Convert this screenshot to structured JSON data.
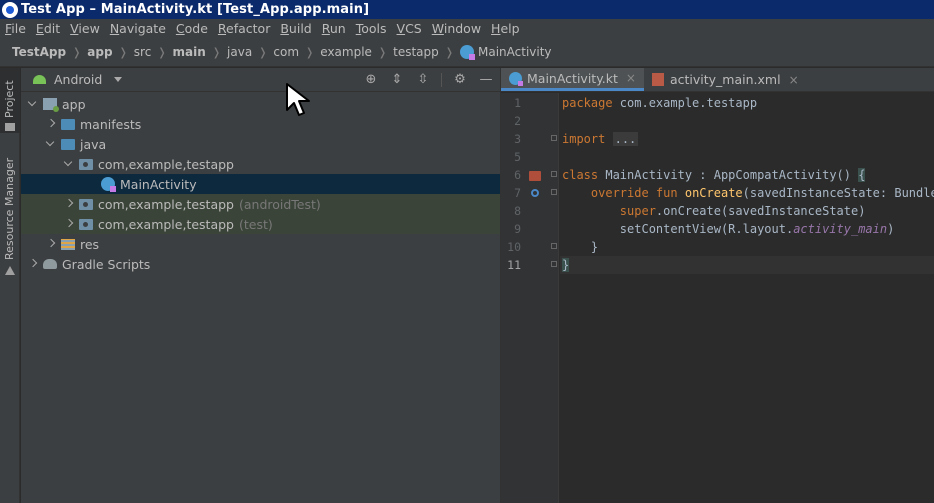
{
  "window": {
    "title": "Test App – MainActivity.kt [Test_App.app.main]"
  },
  "menu": [
    {
      "label": "File",
      "m": "F",
      "rest": "ile"
    },
    {
      "label": "Edit",
      "m": "E",
      "rest": "dit"
    },
    {
      "label": "View",
      "m": "V",
      "rest": "iew"
    },
    {
      "label": "Navigate",
      "m": "N",
      "rest": "avigate"
    },
    {
      "label": "Code",
      "m": "C",
      "rest": "ode"
    },
    {
      "label": "Refactor",
      "m": "R",
      "rest": "efactor"
    },
    {
      "label": "Build",
      "m": "B",
      "rest": "uild"
    },
    {
      "label": "Run",
      "m": "R",
      "rest": "un"
    },
    {
      "label": "Tools",
      "m": "T",
      "rest": "ools"
    },
    {
      "label": "VCS",
      "m": "V",
      "rest": "CS"
    },
    {
      "label": "Window",
      "m": "W",
      "rest": "indow"
    },
    {
      "label": "Help",
      "m": "H",
      "rest": "elp"
    }
  ],
  "breadcrumb": [
    "TestApp",
    "app",
    "src",
    "main",
    "java",
    "com",
    "example",
    "testapp",
    "MainActivity"
  ],
  "side_tabs": {
    "project": "Project",
    "resource_manager": "Resource Manager"
  },
  "project_panel": {
    "view_mode": "Android",
    "tree": [
      {
        "label": "app",
        "suffix": ""
      },
      {
        "label": "manifests",
        "suffix": ""
      },
      {
        "label": "java",
        "suffix": ""
      },
      {
        "label": "com,example,testapp",
        "suffix": ""
      },
      {
        "label": "MainActivity",
        "suffix": ""
      },
      {
        "label": "com,example,testapp",
        "suffix": "(androidTest)"
      },
      {
        "label": "com,example,testapp",
        "suffix": "(test)"
      },
      {
        "label": "res",
        "suffix": ""
      },
      {
        "label": "Gradle Scripts",
        "suffix": ""
      }
    ]
  },
  "editor": {
    "tabs": [
      {
        "label": "MainActivity.kt",
        "close": "×"
      },
      {
        "label": "activity_main.xml",
        "close": "×"
      }
    ],
    "lines": [
      "1",
      "2",
      "3",
      "5",
      "6",
      "7",
      "8",
      "9",
      "10",
      "11"
    ],
    "code": {
      "l1_kw": "package",
      "l1_rest": " com.example.testapp",
      "l3_kw": "import",
      "l3_fold": "...",
      "l6_kw": "class",
      "l6_rest": " MainActivity : AppCompatActivity() ",
      "l6_brace": "{",
      "l7_kw": "override fun",
      "l7_fn": "onCreate",
      "l7_rest": "(savedInstanceState: Bundle?) {",
      "l8_kw": "super",
      "l8_rest": ".onCreate(savedInstanceState)",
      "l9_a": "setContentView(R.layout.",
      "l9_it": "activity_main",
      "l9_b": ")",
      "l10": "}",
      "l11_brace": "}"
    }
  }
}
